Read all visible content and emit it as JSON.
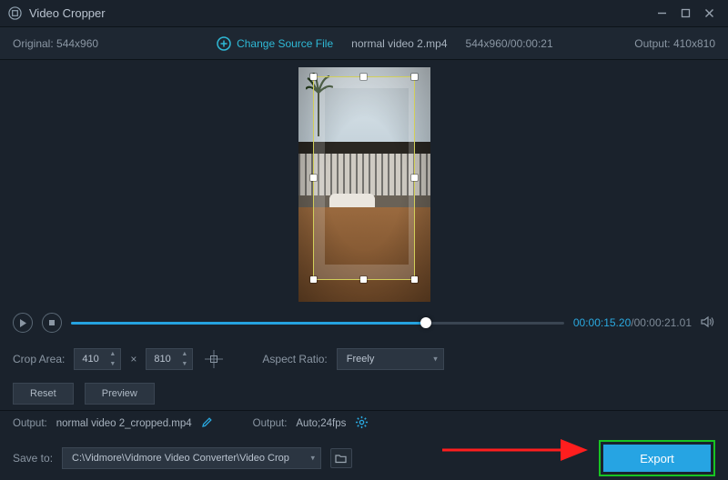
{
  "app": {
    "title": "Video Cropper"
  },
  "window_controls": {
    "minimize": "minimize",
    "maximize": "maximize",
    "close": "close"
  },
  "topbar": {
    "original_label": "Original:",
    "original_dims": "544x960",
    "change_source": "Change Source File",
    "filename": "normal video 2.mp4",
    "source_meta": "544x960/00:00:21",
    "output_label": "Output:",
    "output_dims": "410x810"
  },
  "playback": {
    "current": "00:00:15.20",
    "total": "00:00:21.01",
    "progress_pct": 72
  },
  "crop": {
    "area_label": "Crop Area:",
    "width": "410",
    "height": "810",
    "aspect_label": "Aspect Ratio:",
    "aspect_value": "Freely",
    "reset": "Reset",
    "preview": "Preview"
  },
  "output": {
    "file_label": "Output:",
    "file_value": "normal video 2_cropped.mp4",
    "fmt_label": "Output:",
    "fmt_value": "Auto;24fps"
  },
  "save": {
    "label": "Save to:",
    "path": "C:\\Vidmore\\Vidmore Video Converter\\Video Crop"
  },
  "export": {
    "label": "Export"
  },
  "icons": {
    "app": "crop-app-icon",
    "plus": "plus-circle-icon",
    "play": "play-icon",
    "stop": "stop-icon",
    "volume": "volume-icon",
    "recenter": "recenter-icon",
    "pencil": "pencil-icon",
    "gear": "gear-icon",
    "folder": "folder-open-icon"
  }
}
